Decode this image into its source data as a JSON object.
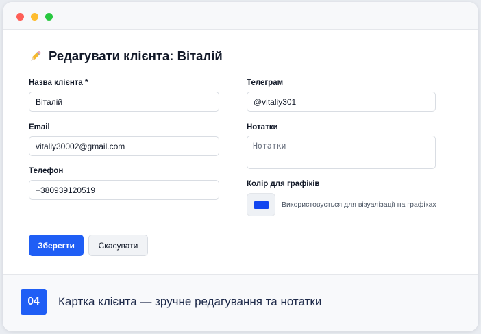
{
  "theme": {
    "accent": "#1f5ef5",
    "dot_red": "#fe5f57",
    "dot_yellow": "#febc2e",
    "dot_green": "#28c840",
    "chart_color": "#1246f0"
  },
  "form": {
    "title": "Редагувати клієнта: Віталій",
    "title_icon": "pencil-icon",
    "name_label": "Назва клієнта *",
    "name_value": "Віталій",
    "email_label": "Email",
    "email_value": "vitaliy30002@gmail.com",
    "phone_label": "Телефон",
    "phone_value": "+380939120519",
    "telegram_label": "Телеграм",
    "telegram_value": "@vitaliy301",
    "notes_label": "Нотатки",
    "notes_value": "",
    "notes_placeholder": "Нотатки",
    "color_label": "Колір для графіків",
    "color_hint": "Використовується для візуалізації на графіках",
    "save_label": "Зберегти",
    "cancel_label": "Скасувати"
  },
  "footer": {
    "step": "04",
    "caption": "Картка клієнта — зручне редагування та нотатки"
  }
}
